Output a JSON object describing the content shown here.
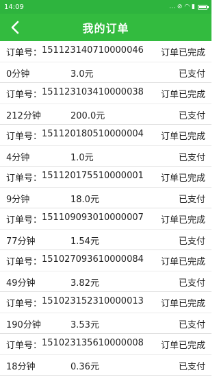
{
  "status": {
    "time": "14:09",
    "icons": "… ⊘ ◠ ▮"
  },
  "header": {
    "title": "我的订单",
    "back_icon": "chevron-left-icon"
  },
  "labels": {
    "order_prefix": "订单号："
  },
  "orders": [
    {
      "order_no": "151123140710000046",
      "state": "订单已完成",
      "duration": "0分钟",
      "amount": "3.0元",
      "pay": "已支付"
    },
    {
      "order_no": "151123103410000038",
      "state": "订单已完成",
      "duration": "212分钟",
      "amount": "200.0元",
      "pay": "已支付"
    },
    {
      "order_no": "151120180510000004",
      "state": "订单已完成",
      "duration": "4分钟",
      "amount": "1.0元",
      "pay": "已支付"
    },
    {
      "order_no": "151120175510000001",
      "state": "订单已完成",
      "duration": "9分钟",
      "amount": "18.0元",
      "pay": "已支付"
    },
    {
      "order_no": "151109093010000007",
      "state": "订单已完成",
      "duration": "77分钟",
      "amount": "1.54元",
      "pay": "已支付"
    },
    {
      "order_no": "151027093610000084",
      "state": "订单已完成",
      "duration": "49分钟",
      "amount": "3.82元",
      "pay": "已支付"
    },
    {
      "order_no": "151023152310000013",
      "state": "订单已完成",
      "duration": "190分钟",
      "amount": "3.53元",
      "pay": "已支付"
    },
    {
      "order_no": "151023135610000008",
      "state": "订单已完成",
      "duration": "18分钟",
      "amount": "0.36元",
      "pay": "已支付"
    }
  ],
  "colors": {
    "brand": "#33bb3f",
    "status_bar": "#2eb43e"
  }
}
